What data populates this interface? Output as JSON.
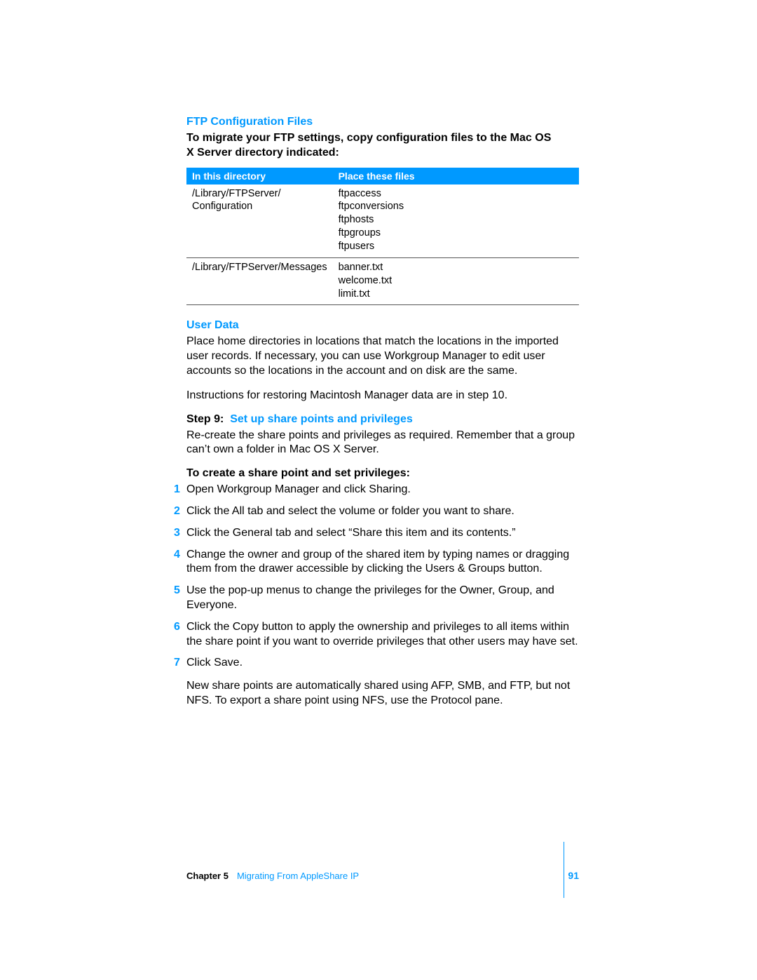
{
  "headings": {
    "ftp": "FTP Configuration Files",
    "user_data": "User Data"
  },
  "intro_bold": "To migrate your FTP settings, copy configuration files to the Mac OS X Server directory indicated:",
  "table": {
    "headers": [
      "In this directory",
      "Place these files"
    ],
    "rows": [
      {
        "dir": "/Library/FTPServer/\nConfiguration",
        "files": "ftpaccess\nftpconversions\nftphosts\nftpgroups\nftpusers"
      },
      {
        "dir": "/Library/FTPServer/Messages",
        "files": "banner.txt\nwelcome.txt\nlimit.txt"
      }
    ]
  },
  "user_data_para": "Place home directories in locations that match the locations in the imported user records. If necessary, you can use Workgroup Manager to edit user accounts so the locations in the account and on disk are the same.",
  "restore_para": "Instructions for restoring Macintosh Manager data are in step 10.",
  "step9": {
    "label": "Step 9:  ",
    "title": "Set up share points and privileges",
    "para": "Re-create the share points and privileges as required. Remember that a group can’t own a folder in Mac OS X Server.",
    "subhead": "To create a share point and set privileges:",
    "items": [
      "Open Workgroup Manager and click Sharing.",
      "Click the All tab and select the volume or folder you want to share.",
      "Click the General tab and select “Share this item and its contents.”",
      "Change the owner and group of the shared item by typing names or dragging them from the drawer accessible by clicking the Users & Groups button.",
      "Use the pop-up menus to change the privileges for the Owner, Group, and Everyone.",
      "Click the Copy button to apply the ownership and privileges to all items within the share point if you want to override privileges that other users may have set.",
      "Click Save."
    ],
    "closing": "New share points are automatically shared using AFP, SMB, and FTP, but not NFS. To export a share point using NFS, use the Protocol pane."
  },
  "footer": {
    "chapter_label": "Chapter 5",
    "chapter_title": "Migrating From AppleShare IP",
    "page": "91"
  }
}
